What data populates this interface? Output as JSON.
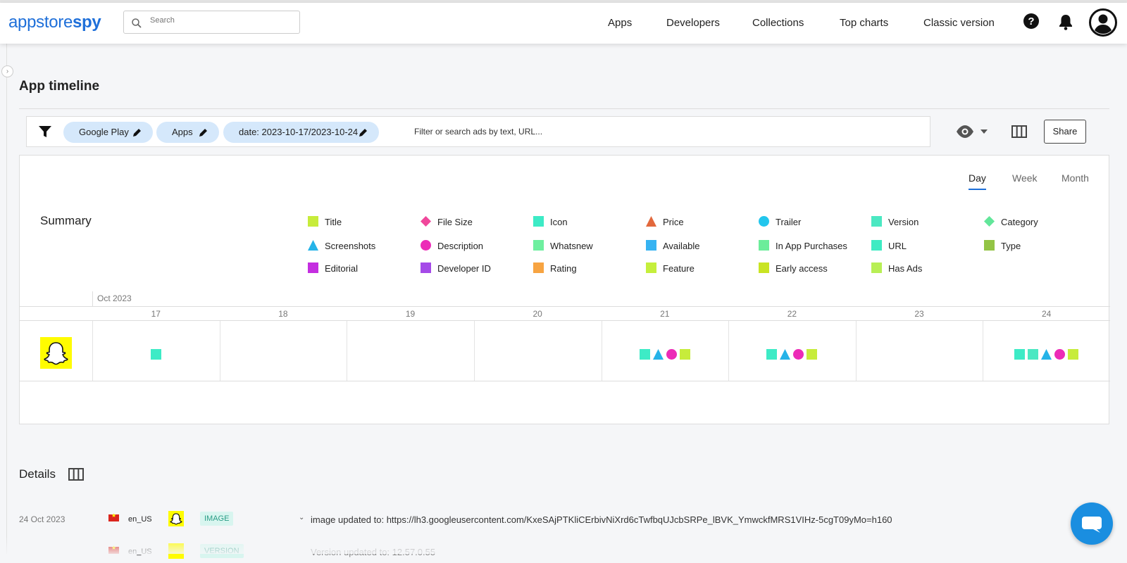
{
  "header": {
    "logo_light": "appstore",
    "logo_bold": "spy",
    "search_placeholder": "Search",
    "nav": [
      "Apps",
      "Developers",
      "Collections",
      "Top charts",
      "Classic version"
    ]
  },
  "page": {
    "title": "App timeline"
  },
  "filters": {
    "chips": [
      "Google Play",
      "Apps",
      "date: 2023-10-17/2023-10-24"
    ],
    "hint": "Filter or search ads by text, URL...",
    "share_label": "Share"
  },
  "timeline": {
    "tabs": [
      "Day",
      "Week",
      "Month"
    ],
    "active_tab": "Day",
    "summary_label": "Summary",
    "legend": [
      {
        "label": "Title",
        "shape": "square",
        "color": "#c7ec3b"
      },
      {
        "label": "File Size",
        "shape": "diamond",
        "color": "#f0479b"
      },
      {
        "label": "Icon",
        "shape": "square",
        "color": "#3debc6"
      },
      {
        "label": "Price",
        "shape": "triangle",
        "color": "#e2683c"
      },
      {
        "label": "Trailer",
        "shape": "circle",
        "color": "#22c6ed"
      },
      {
        "label": "Version",
        "shape": "square",
        "color": "#4be8c2"
      },
      {
        "label": "Category",
        "shape": "diamond",
        "color": "#62e69a"
      },
      {
        "label": "Screenshots",
        "shape": "triangle",
        "color": "#25b3e8"
      },
      {
        "label": "Description",
        "shape": "circle",
        "color": "#ec2bb7"
      },
      {
        "label": "Whatsnew",
        "shape": "square",
        "color": "#6eef9f"
      },
      {
        "label": "Available",
        "shape": "square",
        "color": "#36b3f2"
      },
      {
        "label": "In App Purchases",
        "shape": "square",
        "color": "#6ced9a"
      },
      {
        "label": "URL",
        "shape": "square",
        "color": "#3eebc3"
      },
      {
        "label": "Type",
        "shape": "square",
        "color": "#93c445"
      },
      {
        "label": "Editorial",
        "shape": "square",
        "color": "#c42ee0"
      },
      {
        "label": "Developer ID",
        "shape": "square",
        "color": "#a54ae8"
      },
      {
        "label": "Rating",
        "shape": "square",
        "color": "#f7a442"
      },
      {
        "label": "Feature",
        "shape": "square",
        "color": "#c5ef3c"
      },
      {
        "label": "Early access",
        "shape": "square",
        "color": "#c9e423"
      },
      {
        "label": "Has Ads",
        "shape": "square",
        "color": "#b8ef55"
      }
    ],
    "month_label": "Oct 2023",
    "days": [
      "17",
      "18",
      "19",
      "20",
      "21",
      "22",
      "23",
      "24"
    ],
    "day_changes": [
      [
        "Icon"
      ],
      [],
      [],
      [],
      [
        "Icon",
        "Screenshots",
        "Description",
        "Title"
      ],
      [
        "Icon",
        "Screenshots",
        "Description",
        "Title"
      ],
      [],
      [
        "Icon",
        "Version",
        "Screenshots",
        "Description",
        "Title"
      ]
    ]
  },
  "details": {
    "title": "Details",
    "rows": [
      {
        "date": "24 Oct 2023",
        "locale": "en_US",
        "type": "IMAGE",
        "message": "image updated to: https://lh3.googleusercontent.com/KxeSAjPTKliCErbivNiXrd6cTwfbqUJcbSRPe_lBVK_YmwckfMRS1VIHz-5cgT09yMo=h160"
      },
      {
        "date": "",
        "locale": "en_US",
        "type": "VERSION",
        "message": "Version updated to: 12.57.0.55"
      }
    ]
  }
}
